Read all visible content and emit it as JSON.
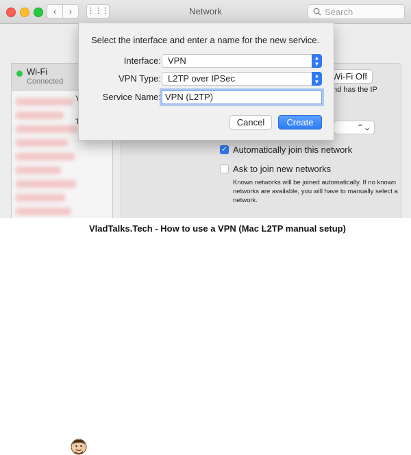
{
  "window": {
    "title": "Network",
    "nav_back": "‹",
    "nav_forward": "›",
    "grid_glyph": "⋮⋮⋮",
    "search_placeholder": "Search"
  },
  "sidebar": {
    "items": [
      {
        "name": "Wi-Fi",
        "status": "Connected",
        "status_color": "#2ec74a"
      }
    ]
  },
  "background_panel": {
    "wifi_off_button": "Wi-Fi Off",
    "text_fragments": [
      "nd has the IP",
      "Y",
      "T",
      "⌃⌄"
    ],
    "auto_join_label": "Automatically join this network",
    "auto_join_checked": true,
    "ask_join_label": "Ask to join new networks",
    "ask_join_checked": false,
    "note": "Known networks will be joined automatically. If no known networks are available, you will have to manually select a network."
  },
  "sheet": {
    "prompt": "Select the interface and enter a name for the new service.",
    "interface_label": "Interface:",
    "interface_value": "VPN",
    "vpn_type_label": "VPN Type:",
    "vpn_type_value": "L2TP over IPSec",
    "service_name_label": "Service Name:",
    "service_name_value": "VPN (L2TP)",
    "cancel_label": "Cancel",
    "create_label": "Create"
  },
  "footer": {
    "caption": "VladTalks.Tech - How to use a VPN (Mac L2TP manual setup)"
  },
  "colors": {
    "accent": "#2f7bf5",
    "window_bg": "#ececec"
  },
  "icons": {
    "close": "close-light-icon",
    "minimize": "minimize-light-icon",
    "zoom": "zoom-light-icon",
    "search": "magnifier-icon",
    "popup": "updown-chevron-icon"
  }
}
